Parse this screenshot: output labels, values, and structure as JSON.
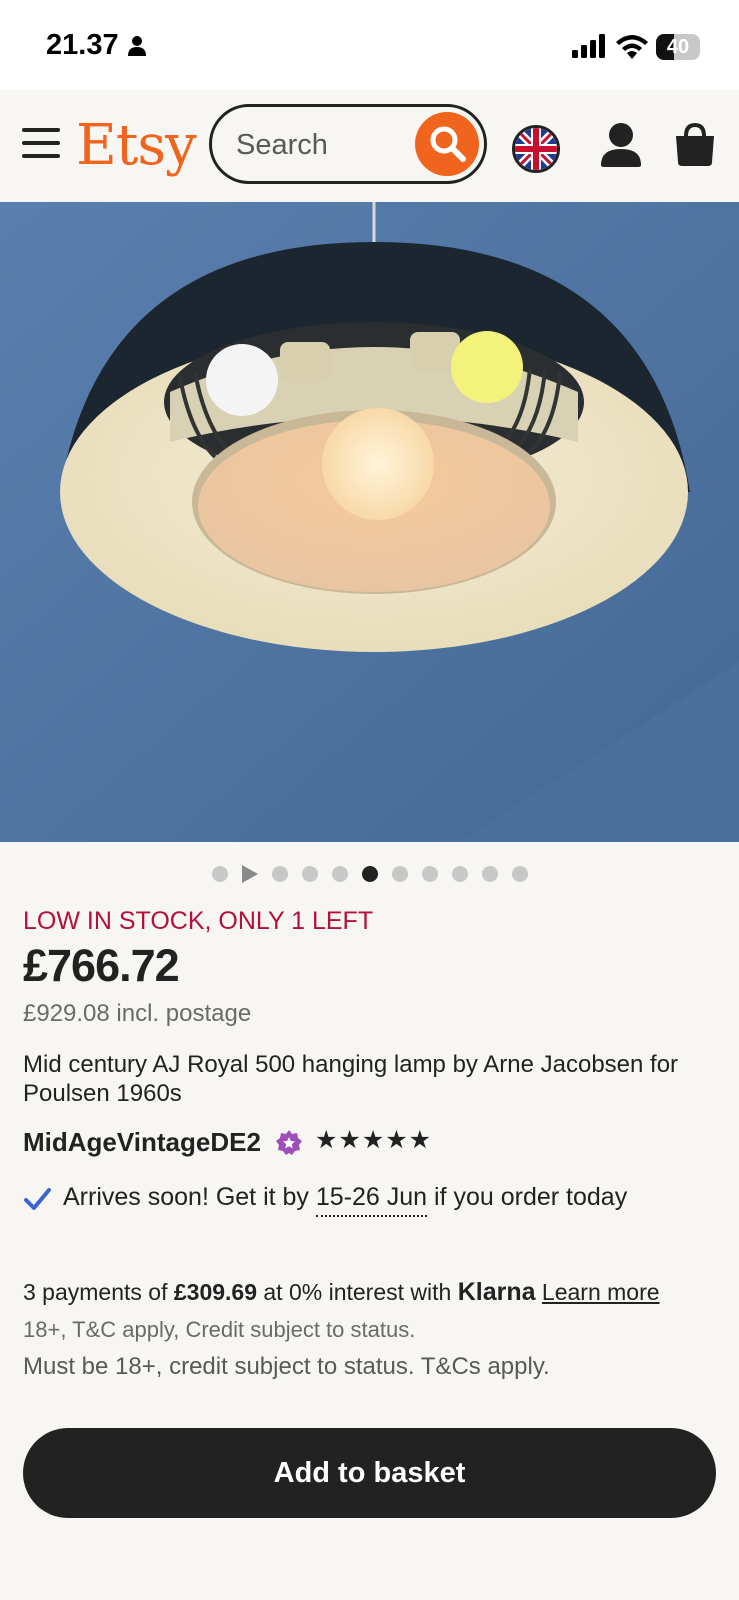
{
  "status_bar": {
    "time": "21.37",
    "battery": "40"
  },
  "header": {
    "logo": "Etsy",
    "search_placeholder": "Search"
  },
  "colors": {
    "brand": "#f1641e",
    "stock_warning": "#b3103b",
    "primary_button": "#222222",
    "check": "#3b63d3"
  },
  "gallery": {
    "total_slides": 11,
    "has_video_indicator": true,
    "active_index": 5
  },
  "product": {
    "stock_notice": "LOW IN STOCK, ONLY 1 LEFT",
    "price": "£766.72",
    "price_with_postage": "£929.08 incl. postage",
    "title": "Mid century AJ Royal 500 hanging lamp by Arne Jacobsen for Poulsen 1960s",
    "shop_name": "MidAgeVintageDE2",
    "rating_stars": "★★★★★",
    "rating": 5,
    "arrival_prefix": "Arrives soon! Get it by ",
    "arrival_dates": "15-26 Jun",
    "arrival_suffix": " if you order today"
  },
  "klarna": {
    "prefix": "3 payments of ",
    "amount": "£309.69",
    "middle": " at 0% interest with ",
    "brand": "Klarna",
    "learn_more": "Learn more",
    "fine_print": "18+, T&C apply, Credit subject to status.",
    "fine_print_2": "Must be 18+, credit subject to status. T&Cs apply."
  },
  "actions": {
    "add_to_basket": "Add to basket"
  }
}
